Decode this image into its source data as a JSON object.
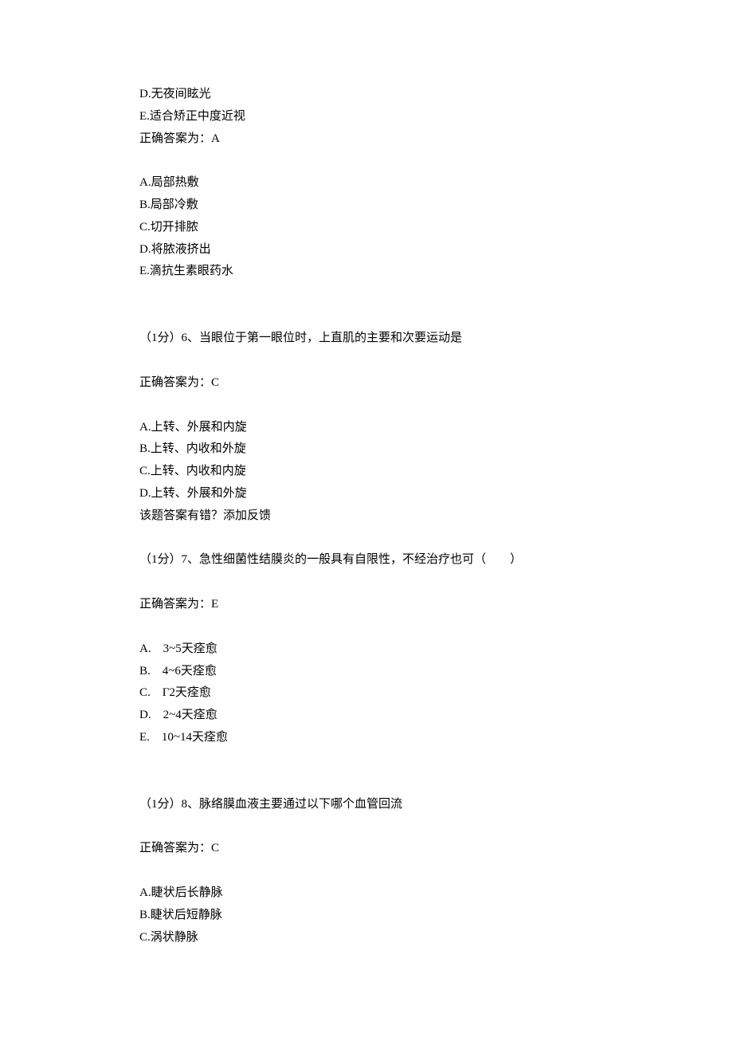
{
  "q5_opts": {
    "d": "D.无夜间眩光",
    "e": "E.适合矫正中度近视"
  },
  "q5_answer": "正确答案为：A",
  "q5b_opts": {
    "a": "A.局部热敷",
    "b": "B.局部冷敷",
    "c": "C.切开排脓",
    "d": "D.将脓液挤出",
    "e": "E.滴抗生素眼药水"
  },
  "q6": {
    "stem": "（1分）6、当眼位于第一眼位时，上直肌的主要和次要运动是",
    "answer": "正确答案为：C",
    "a": "A.上转、外展和内旋",
    "b": "B.上转、内收和外旋",
    "c": "C.上转、内收和内旋",
    "d": "D.上转、外展和外旋",
    "feedback": "该题答案有错？添加反馈"
  },
  "q7": {
    "stem": "（1分）7、急性细菌性结膜炎的一般具有自限性，不经治疗也可（　　）",
    "answer": "正确答案为：E",
    "a": "A.　3~5天痊愈",
    "b": "B.　4~6天痊愈",
    "c": "C.　Г2天痊愈",
    "d": "D.　2~4天痊愈",
    "e": "E.　10~14天痊愈"
  },
  "q8": {
    "stem": "（1分）8、脉络膜血液主要通过以下哪个血管回流",
    "answer": "正确答案为：C",
    "a": "A.睫状后长静脉",
    "b": "B.睫状后短静脉",
    "c": "C.涡状静脉"
  }
}
